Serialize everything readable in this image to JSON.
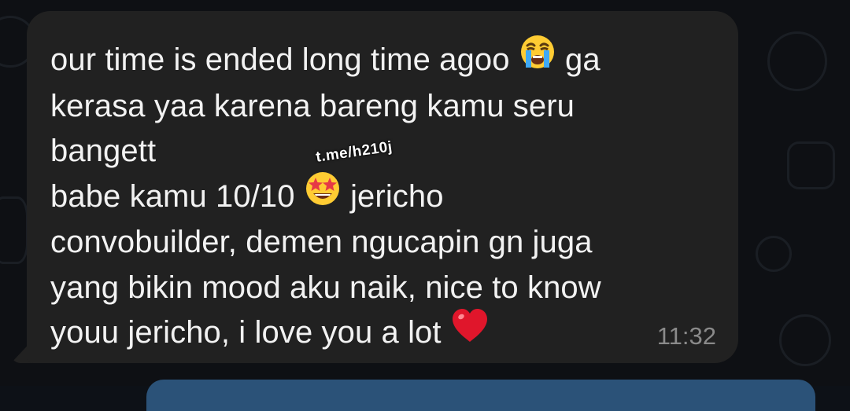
{
  "chat": {
    "message": {
      "lines": [
        "our time is ended long time agoo",
        "ga",
        "kerasa yaa karena bareng kamu seru",
        "bangett",
        "babe kamu 10/10",
        "jericho",
        "convobuilder, demen ngucapin gn juga",
        "yang bikin mood aku naik, nice to know",
        "youu jericho, i love you a lot"
      ],
      "timestamp": "11:32",
      "watermark": "t.me/h210j",
      "emojis": [
        "loudly-crying-face-icon",
        "star-struck-icon",
        "red-heart-icon"
      ]
    },
    "colors": {
      "bubble": "#212121",
      "text": "#f2f2f2",
      "timestamp": "#8a8a8a",
      "outgoing_bubble": "#2b5278"
    }
  }
}
